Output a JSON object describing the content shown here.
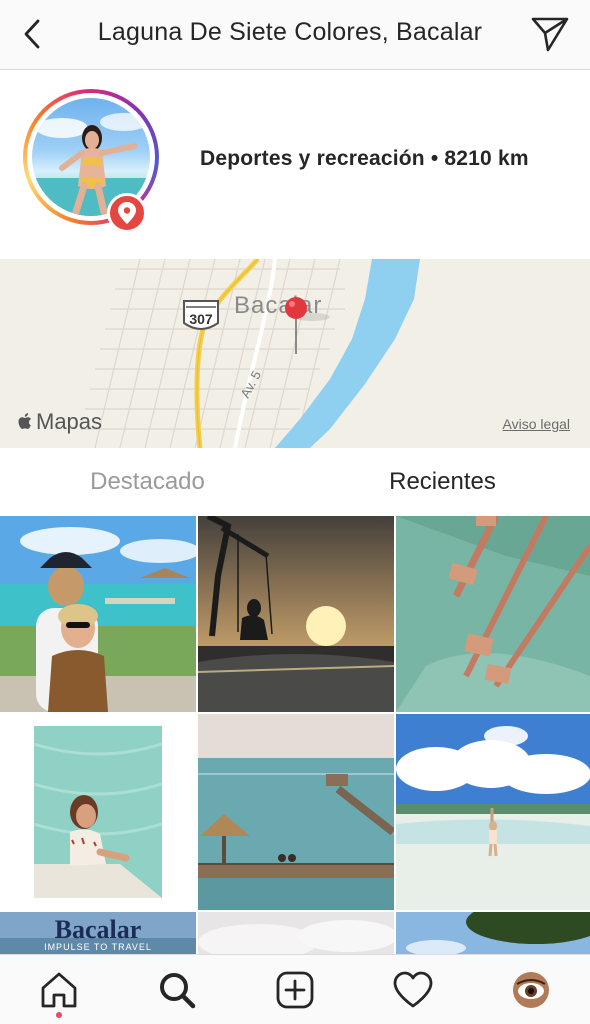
{
  "header": {
    "title": "Laguna De Siete Colores, Bacalar",
    "back_icon": "chevron-left-icon",
    "share_icon": "paper-plane-icon"
  },
  "profile": {
    "meta": "Deportes y recreación • 8210 km",
    "badge_icon": "location-pin-icon",
    "ring_colors": [
      "#f58529",
      "#dd2a7b",
      "#8134af",
      "#515bd4"
    ],
    "badge_color": "#e5463f"
  },
  "map": {
    "town_label": "Bacalar",
    "highway_label": "307",
    "street_label": "Av. 5",
    "attribution": "Mapas",
    "legal": "Aviso legal",
    "pin_color": "#e0383e",
    "water_color": "#8fd0f0",
    "road_color": "#f5cf4a"
  },
  "tabs": [
    {
      "label": "Destacado",
      "active": false
    },
    {
      "label": "Recientes",
      "active": true
    }
  ],
  "grid": {
    "tiles": [
      {
        "name": "photo-dock-couple"
      },
      {
        "name": "photo-swing-sunset"
      },
      {
        "name": "photo-aerial-piers"
      },
      {
        "name": "photo-woman-water"
      },
      {
        "name": "photo-pier-palapa"
      },
      {
        "name": "photo-woman-shore-clouds"
      },
      {
        "name": "photo-bacalar-banner",
        "title": "Bacalar",
        "subtitle": "IMPULSE TO TRAVEL"
      },
      {
        "name": "photo-cloudy-sky"
      },
      {
        "name": "photo-tree-sky"
      }
    ]
  },
  "bottom_nav": [
    {
      "icon": "home-icon",
      "active": true
    },
    {
      "icon": "search-icon",
      "active": false
    },
    {
      "icon": "add-post-icon",
      "active": false
    },
    {
      "icon": "heart-icon",
      "active": false
    },
    {
      "icon": "profile-avatar-icon",
      "active": false
    }
  ]
}
